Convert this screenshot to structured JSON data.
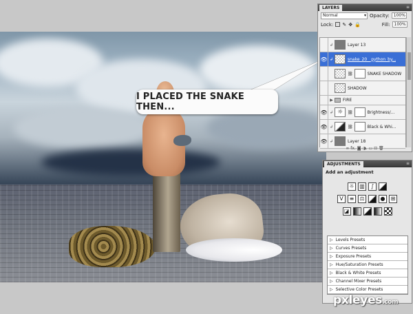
{
  "canvas": {
    "speech_bubble": "I PLACED THE SNAKE THEN..."
  },
  "layers_panel": {
    "tab": "LAYERS",
    "blend_mode": "Normal",
    "opacity_label": "Opacity:",
    "opacity_value": "100%",
    "lock_label": "Lock:",
    "fill_label": "Fill:",
    "fill_value": "100%",
    "layers": [
      {
        "name": "Layer 13",
        "thumb": "gray"
      },
      {
        "name": "snake_20__python_by...",
        "thumb": "transparent",
        "selected": true
      },
      {
        "name": "SNAKE SHADOW",
        "thumb": "transparent",
        "mask": true
      },
      {
        "name": "SHADOW",
        "thumb": "transparent"
      },
      {
        "name": "FIRE",
        "type": "group"
      },
      {
        "name": "Brightness/...",
        "thumb": "sun",
        "mask": true
      },
      {
        "name": "Black & Whi...",
        "thumb": "adj",
        "mask": true
      },
      {
        "name": "Layer 18",
        "thumb": "gray"
      }
    ],
    "footer_icons": "∞  fx.  ◙  ◑.  ▭  ⊡  🗑"
  },
  "adjustments_panel": {
    "tab": "ADJUSTMENTS",
    "title": "Add an adjustment",
    "presets": [
      "Levels Presets",
      "Curves Presets",
      "Exposure Presets",
      "Hue/Saturation Presets",
      "Black & White Presets",
      "Channel Mixer Presets",
      "Selective Color Presets"
    ]
  },
  "watermark": {
    "text": "pxleyes",
    "suffix": ".com"
  },
  "colors": {
    "selected_layer": "#3a6fd6",
    "panel_bg": "#e6e6e6",
    "workspace_bg": "#c8c8c8"
  }
}
